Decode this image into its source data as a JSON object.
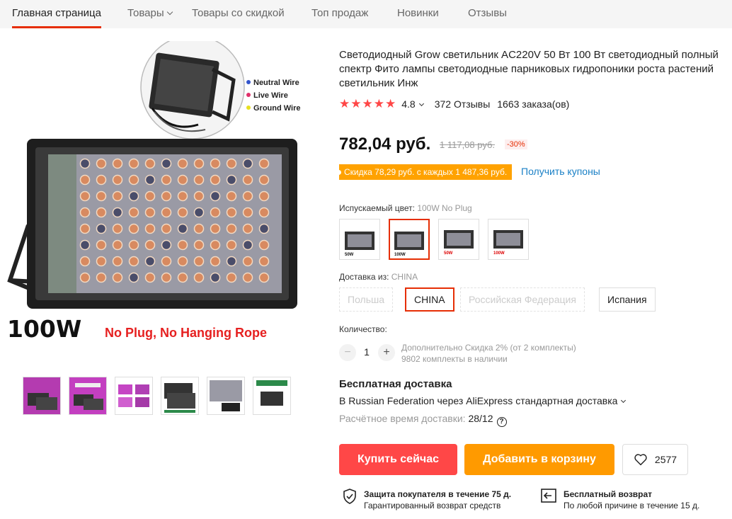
{
  "nav": {
    "items": [
      {
        "label": "Главная страница"
      },
      {
        "label": "Товары"
      },
      {
        "label": "Товары со скидкой"
      },
      {
        "label": "Топ продаж"
      },
      {
        "label": "Новинки"
      },
      {
        "label": "Отзывы"
      }
    ]
  },
  "gallery": {
    "wire_legend": [
      "Neutral Wire",
      "Live Wire",
      "Ground Wire"
    ],
    "wire_colors": [
      "#3355cc",
      "#e0306a",
      "#e8e020"
    ],
    "power_label": "100W",
    "note": "No Plug, No Hanging Rope",
    "thumbnail_count": 6
  },
  "product": {
    "title": "Светодиодный Grow светильник AC220V 50 Вт 100 Вт светодиодный полный спектр Фито лампы светодиодные парниковых гидропоники роста растений светильник Инж",
    "rating": "4.8",
    "reviews": "372 Отзывы",
    "orders": "1663 заказа(ов)",
    "price": "782,04 руб.",
    "old_price": "1 117,08 руб.",
    "discount": "-30%",
    "coupon_text": "Скидка 78,29 руб. с каждых 1 487,36 руб.",
    "coupon_link": "Получить купоны"
  },
  "color": {
    "label": "Испускаемый цвет:",
    "selected": "100W No Plug",
    "swatch_captions": [
      "50W",
      "100W",
      "50W",
      "100W"
    ]
  },
  "shipping_from": {
    "label": "Доставка из:",
    "selected": "CHINA",
    "options": [
      "Польша",
      "CHINA",
      "Российская Федерация",
      "Испания"
    ]
  },
  "quantity": {
    "label": "Количество:",
    "value": "1",
    "minus": "−",
    "plus": "+",
    "note_line1": "Дополнительно Скидка 2% (от 2 комплекты)",
    "note_line2": "9802 комплекты в наличии"
  },
  "delivery": {
    "title": "Бесплатная доставка",
    "route": "В Russian Federation через AliExpress стандартная доставка",
    "time_label": "Расчётное время доставки:",
    "time_value": "28/12",
    "help": "?"
  },
  "actions": {
    "buy": "Купить сейчас",
    "cart": "Добавить в корзину",
    "wishlist_count": "2577"
  },
  "guarantees": {
    "protection_title": "Защита покупателя в течение 75 д.",
    "protection_text": "Гарантированный возврат средств",
    "return_title": "Бесплатный возврат",
    "return_text": "По любой причине в течение 15 д."
  },
  "colors": {
    "accent": "#ff4747",
    "nav_underline": "#e62e04",
    "cart": "#ff9a00",
    "coupon": "#ffa200",
    "link": "#1a80c6"
  }
}
